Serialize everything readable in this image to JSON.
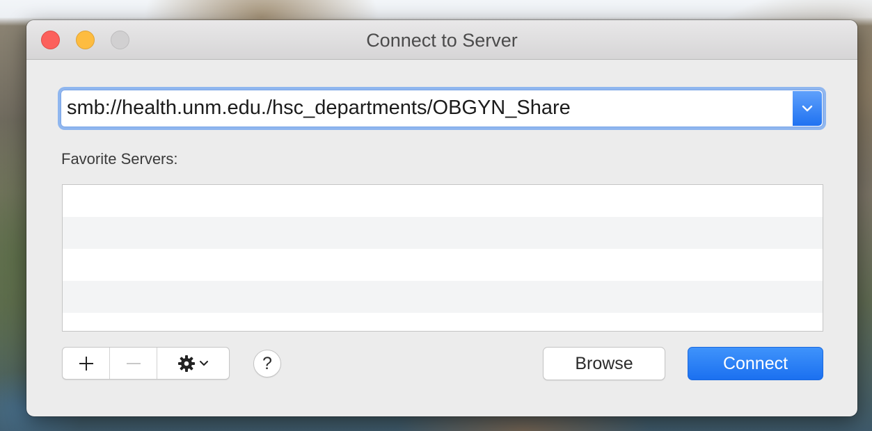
{
  "window": {
    "title": "Connect to Server"
  },
  "server_address": {
    "value": "smb://health.unm.edu./hsc_departments/OBGYN_Share",
    "dropdown_icon": "chevron-down-icon"
  },
  "favorites": {
    "label": "Favorite Servers:",
    "items": []
  },
  "toolbar": {
    "add_icon": "plus-icon",
    "remove_icon": "minus-icon",
    "action_icon": "gear-icon",
    "help_label": "?"
  },
  "buttons": {
    "browse": "Browse",
    "connect": "Connect"
  },
  "colors": {
    "accent": "#1f72f1",
    "close": "#fc605c",
    "minimize": "#fdbc40",
    "zoom_disabled": "#d1d0d1"
  }
}
